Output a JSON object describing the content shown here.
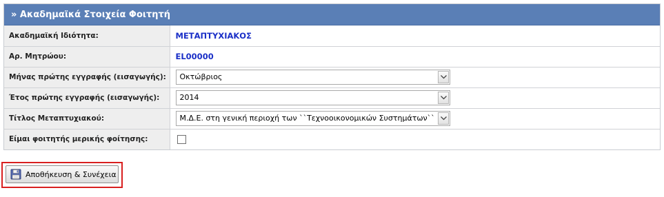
{
  "panel": {
    "title": "» Ακαδημαϊκά Στοιχεία Φοιτητή"
  },
  "rows": [
    {
      "label": "Ακαδημαϊκή Ιδιότητα:",
      "value": "ΜΕΤΑΠΤΥΧΙΑΚΟΣ"
    },
    {
      "label": "Αρ. Μητρώου:",
      "value": "EL00000"
    },
    {
      "label": "Μήνας πρώτης εγγραφής (εισαγωγής):",
      "value": "Οκτώβριος"
    },
    {
      "label": "Έτος πρώτης εγγραφής (εισαγωγής):",
      "value": "2014"
    },
    {
      "label": "Τίτλος Μεταπτυχιακού:",
      "value": "Μ.Δ.Ε. στη γενική περιοχή των ``Τεχνοοικονομικών Συστημάτων``"
    },
    {
      "label": "Είμαι φοιτητής μερικής φοίτησης:",
      "checked": false
    }
  ],
  "actions": {
    "save_label": "Αποθήκευση & Συνέχεια",
    "save_icon": "floppy-disk-icon"
  },
  "colors": {
    "header_bg": "#5a7fb6",
    "value_blue": "#1a2fc7",
    "highlight_border": "#d81e1e"
  }
}
